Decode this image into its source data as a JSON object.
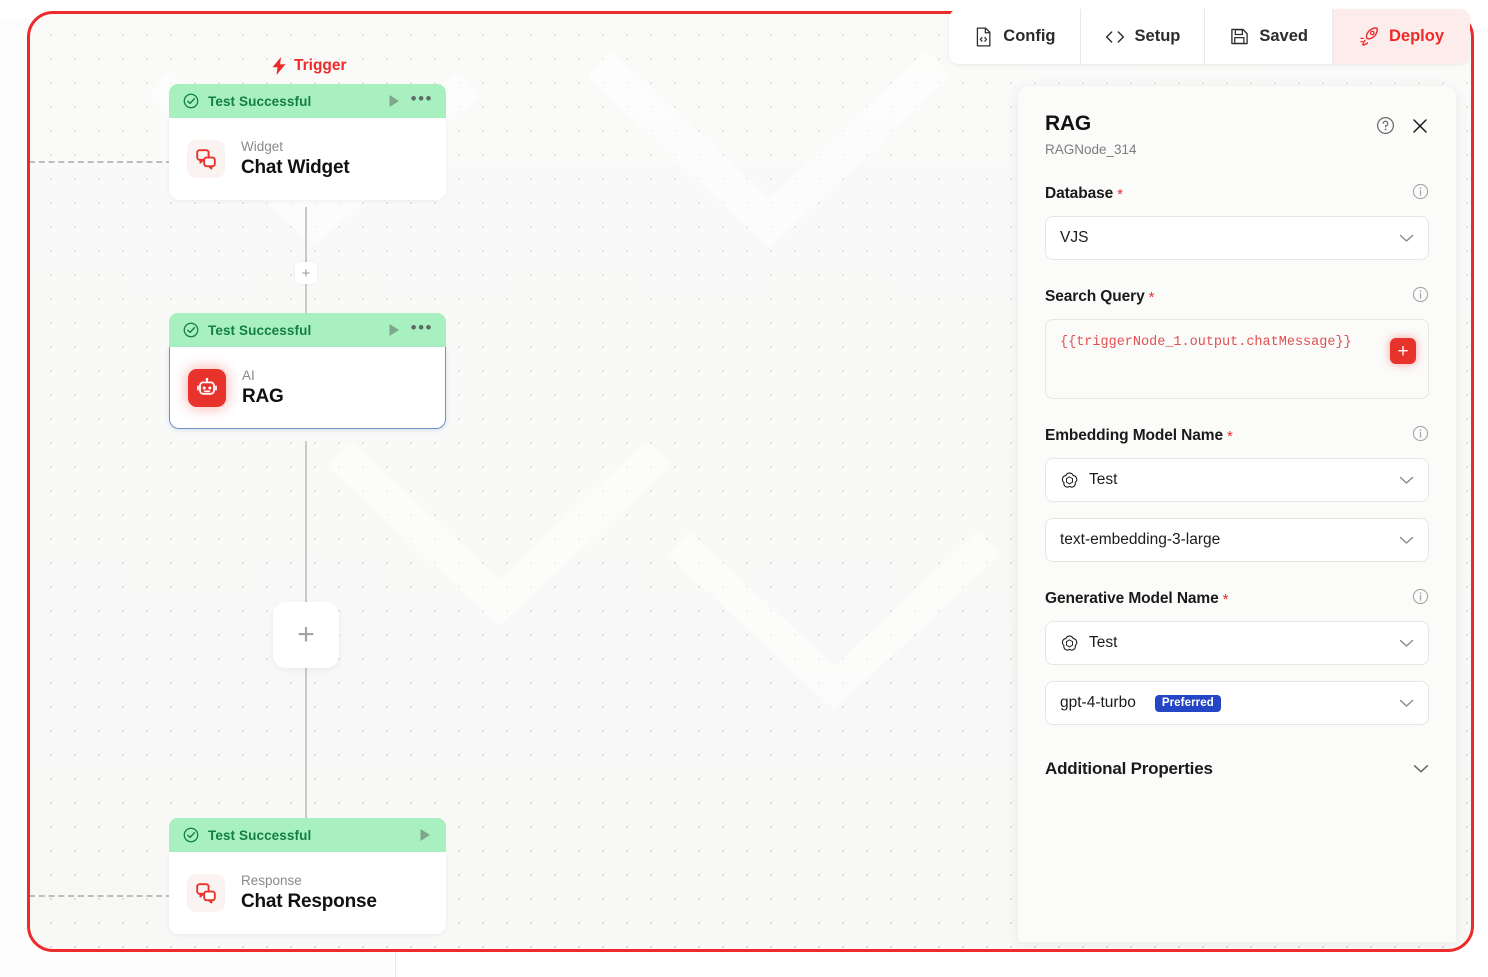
{
  "toolbar": {
    "items": [
      {
        "label": "Config",
        "icon": "file-code-icon",
        "name": "config"
      },
      {
        "label": "Setup",
        "icon": "code-brackets-icon",
        "name": "setup"
      },
      {
        "label": "Saved",
        "icon": "save-disk-icon",
        "name": "saved"
      },
      {
        "label": "Deploy",
        "icon": "rocket-icon",
        "name": "deploy"
      }
    ],
    "accent": "#ee2b2b",
    "deploy_bg": "#fdecec"
  },
  "canvas": {
    "trigger_label": "Trigger",
    "status_text": "Test Successful",
    "status_bg": "#a8f0c0",
    "status_color": "#13803f",
    "add_node_label": "+",
    "nodes": [
      {
        "status": "Test Successful",
        "kind": "Widget",
        "title": "Chat Widget",
        "icon": "chat-bubbles-icon",
        "has_menu": true,
        "selected": false
      },
      {
        "status": "Test Successful",
        "kind": "AI",
        "title": "RAG",
        "icon": "robot-icon",
        "has_menu": true,
        "selected": true
      },
      {
        "status": "Test Successful",
        "kind": "Response",
        "title": "Chat Response",
        "icon": "chat-bubbles-icon",
        "has_menu": false,
        "selected": false
      }
    ]
  },
  "panel": {
    "title": "RAG",
    "subtitle": "RAGNode_314",
    "help_icon": "question-circle-icon",
    "close_icon": "close-icon",
    "fields": {
      "database": {
        "label": "Database",
        "required": "*",
        "value": "VJS"
      },
      "search_query": {
        "label": "Search Query",
        "required": "*",
        "value": "{{triggerNode_1.output.chatMessage}}",
        "add_button": "+"
      },
      "embedding_model": {
        "label": "Embedding Model Name",
        "required": "*",
        "provider": "Test",
        "provider_icon": "openai-icon",
        "model": "text-embedding-3-large"
      },
      "generative_model": {
        "label": "Generative Model Name",
        "required": "*",
        "provider": "Test",
        "provider_icon": "openai-icon",
        "model": "gpt-4-turbo",
        "badge": "Preferred",
        "badge_color": "#2546c4"
      }
    },
    "accordion": {
      "label": "Additional Properties"
    }
  }
}
